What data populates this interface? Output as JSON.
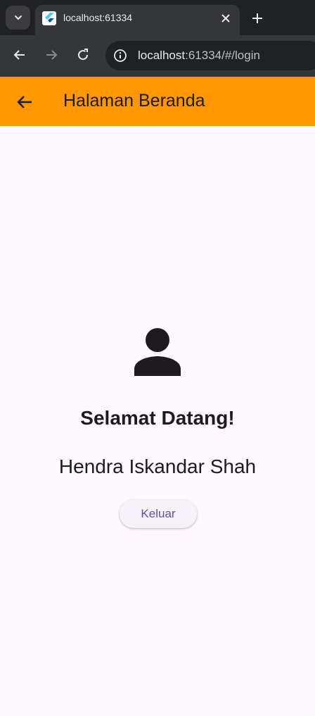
{
  "browser": {
    "tab_title": "localhost:61334",
    "url_host": "localhost",
    "url_rest": ":61334/#/login"
  },
  "appbar": {
    "title": "Halaman Beranda",
    "background": "#ff9800"
  },
  "main": {
    "welcome_text": "Selamat Datang!",
    "user_name": "Hendra Iskandar Shah",
    "logout_label": "Keluar"
  },
  "icons": [
    "tab-list-icon",
    "flutter-favicon",
    "close-icon",
    "plus-icon",
    "back-arrow-icon",
    "forward-arrow-icon",
    "reload-icon",
    "info-icon",
    "arrow-back-icon",
    "person-icon"
  ]
}
